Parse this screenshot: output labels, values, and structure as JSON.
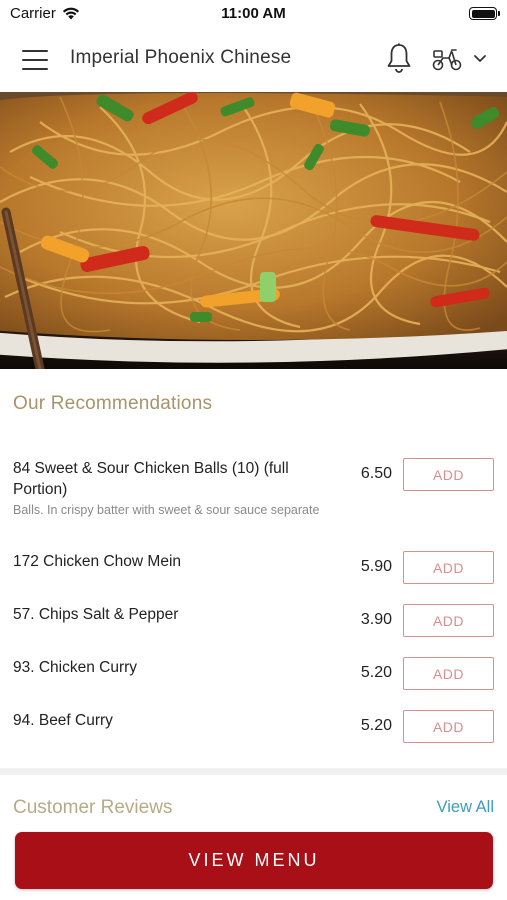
{
  "status_bar": {
    "carrier": "Carrier",
    "time": "11:00 AM"
  },
  "header": {
    "title": "Imperial Phoenix Chinese",
    "icons": [
      "menu-icon",
      "bell-icon",
      "scooter-icon",
      "chevron-down-icon"
    ]
  },
  "hero": {
    "subject": "noodle-dish-photo"
  },
  "recommendations": {
    "title": "Our Recommendations",
    "add_label": "ADD",
    "items": [
      {
        "name": "84 Sweet & Sour Chicken Balls (10) (full Portion)",
        "description": "Balls. In crispy batter with sweet & sour sauce separate",
        "price": "6.50"
      },
      {
        "name": "172 Chicken Chow Mein",
        "description": "",
        "price": "5.90"
      },
      {
        "name": "57. Chips Salt & Pepper",
        "description": "",
        "price": "3.90"
      },
      {
        "name": "93. Chicken Curry",
        "description": "",
        "price": "5.20"
      },
      {
        "name": "94. Beef Curry",
        "description": "",
        "price": "5.20"
      }
    ]
  },
  "reviews": {
    "title": "Customer Reviews",
    "view_all_label": "View All"
  },
  "footer": {
    "view_menu_label": "VIEW MENU"
  },
  "colors": {
    "accent_red": "#a90f16",
    "add_border": "#d88f8f",
    "section_title": "#a8946a",
    "link_blue": "#3d9ac2"
  }
}
